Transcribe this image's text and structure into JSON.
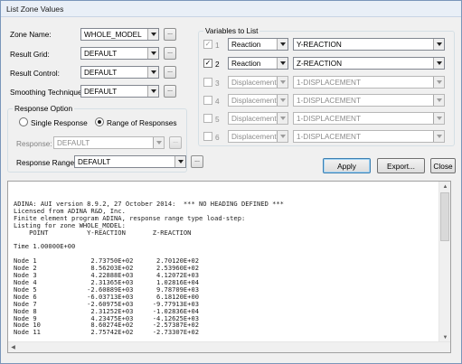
{
  "window": {
    "title": "List Zone Values"
  },
  "left": {
    "zone_name": {
      "label": "Zone Name:",
      "value": "WHOLE_MODEL"
    },
    "result_grid": {
      "label": "Result Grid:",
      "value": "DEFAULT"
    },
    "result_control": {
      "label": "Result Control:",
      "value": "DEFAULT"
    },
    "smoothing": {
      "label": "Smoothing Technique:",
      "value": "DEFAULT"
    },
    "more_label": "..."
  },
  "response_option": {
    "title": "Response Option",
    "single": "Single Response",
    "range": "Range of Responses",
    "selected": "range",
    "response_label": "Response:",
    "response_value": "DEFAULT",
    "range_label": "Response Range:",
    "range_value": "DEFAULT"
  },
  "variables": {
    "title": "Variables to List",
    "rows": [
      {
        "num": "1",
        "checked": true,
        "enabled": false,
        "type": "Reaction",
        "var": "Y-REACTION"
      },
      {
        "num": "2",
        "checked": true,
        "enabled": true,
        "type": "Reaction",
        "var": "Z-REACTION"
      },
      {
        "num": "3",
        "checked": false,
        "enabled": false,
        "type": "Displacement",
        "var": "1-DISPLACEMENT"
      },
      {
        "num": "4",
        "checked": false,
        "enabled": false,
        "type": "Displacement",
        "var": "1-DISPLACEMENT"
      },
      {
        "num": "5",
        "checked": false,
        "enabled": false,
        "type": "Displacement",
        "var": "1-DISPLACEMENT"
      },
      {
        "num": "6",
        "checked": false,
        "enabled": false,
        "type": "Displacement",
        "var": "1-DISPLACEMENT"
      }
    ]
  },
  "buttons": {
    "apply": "Apply",
    "export": "Export...",
    "close": "Close"
  },
  "output": {
    "lines": [
      "ADINA: AUI version 8.9.2, 27 October 2014:  *** NO HEADING DEFINED ***",
      "Licensed from ADINA R&D, Inc.",
      "Finite element program ADINA, response range type load-step:",
      "Listing for zone WHOLE_MODEL:",
      "    POINT          Y-REACTION       Z-REACTION",
      "",
      "Time 1.00000E+00",
      "",
      "Node 1              2.73750E+02      2.70120E+02",
      "Node 2              8.56203E+02      2.53960E+02",
      "Node 3              4.22888E+03      4.12072E+03",
      "Node 4              2.31365E+03      1.02816E+04",
      "Node 5             -2.60889E+03      9.78709E+03",
      "Node 6             -6.03713E+03      6.18120E+00",
      "Node 7             -2.60975E+03     -9.77913E+03",
      "Node 8              2.31252E+03     -1.02836E+04",
      "Node 9              4.23475E+03     -4.12625E+03",
      "Node 10             8.60274E+02     -2.57387E+02",
      "Node 11             2.75742E+02     -2.73307E+02"
    ]
  }
}
